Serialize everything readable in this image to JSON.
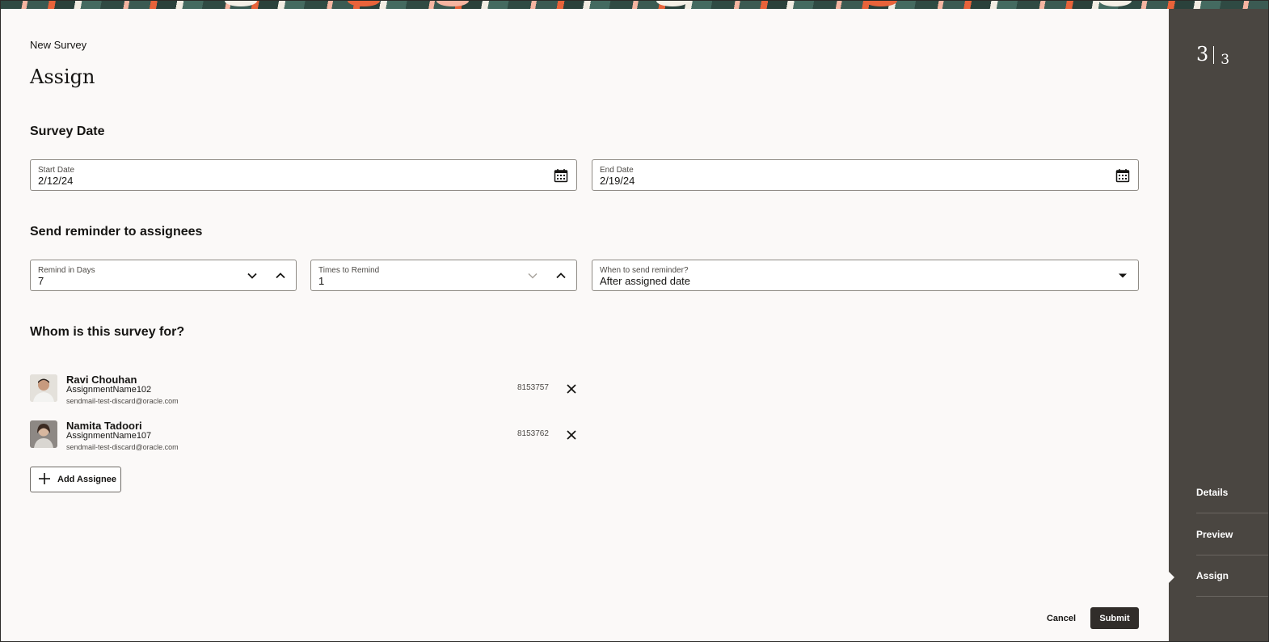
{
  "header": {
    "breadcrumb": "New Survey",
    "title": "Assign"
  },
  "survey_date": {
    "section_title": "Survey Date",
    "start_date": {
      "label": "Start Date",
      "value": "2/12/24",
      "icon": "calendar-icon"
    },
    "end_date": {
      "label": "End Date",
      "value": "2/19/24",
      "icon": "calendar-icon"
    }
  },
  "reminder": {
    "section_title": "Send reminder to assignees",
    "remind_in_days": {
      "label": "Remind in Days",
      "value": "7"
    },
    "times_to_remind": {
      "label": "Times to Remind",
      "value": "1"
    },
    "when_to_send": {
      "label": "When to send reminder?",
      "value": "After assigned date"
    }
  },
  "assignees": {
    "section_title": "Whom is this survey for?",
    "items": [
      {
        "name": "Ravi Chouhan",
        "assignment": "AssignmentName102",
        "email": "sendmail-test-discard@oracle.com",
        "id": "8153757"
      },
      {
        "name": "Namita Tadoori",
        "assignment": "AssignmentName107",
        "email": "sendmail-test-discard@oracle.com",
        "id": "8153762"
      }
    ],
    "add_label": "Add Assignee"
  },
  "actions": {
    "cancel_label": "Cancel",
    "submit_label": "Submit"
  },
  "sidebar": {
    "step_current": "3",
    "step_total": "3",
    "items": [
      {
        "label": "Details"
      },
      {
        "label": "Preview"
      },
      {
        "label": "Assign"
      }
    ],
    "active_index": 2
  },
  "colors": {
    "panel_background": "#fbf9f8",
    "sidebar_background": "#4a4641",
    "primary_button": "#312d2a",
    "text": "#161513"
  }
}
